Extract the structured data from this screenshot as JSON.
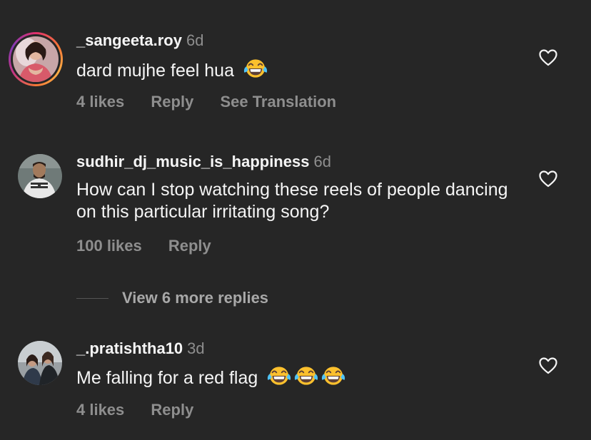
{
  "comments": [
    {
      "username": "_sangeeta.roy",
      "time": "6d",
      "text": "dard mujhe feel hua",
      "emoji_count": 1,
      "likes": "4 likes",
      "reply": "Reply",
      "translation": "See Translation"
    },
    {
      "username": "sudhir_dj_music_is_happiness",
      "time": "6d",
      "text": "How can I stop watching these reels of people dancing on this particular irritating song?",
      "likes": "100 likes",
      "reply": "Reply"
    },
    {
      "username": "_.pratishtha10",
      "time": "3d",
      "text": "Me falling for a red flag",
      "emoji_count": 3,
      "likes": "4 likes",
      "reply": "Reply"
    }
  ],
  "view_more": "View 6 more replies",
  "icons": {
    "like": "heart-outline-icon",
    "emoji": "face-with-tears-of-joy-emoji"
  },
  "colors": {
    "background": "#262626",
    "primary_text": "#f5f5f5",
    "secondary_text": "#8e8e8e"
  }
}
